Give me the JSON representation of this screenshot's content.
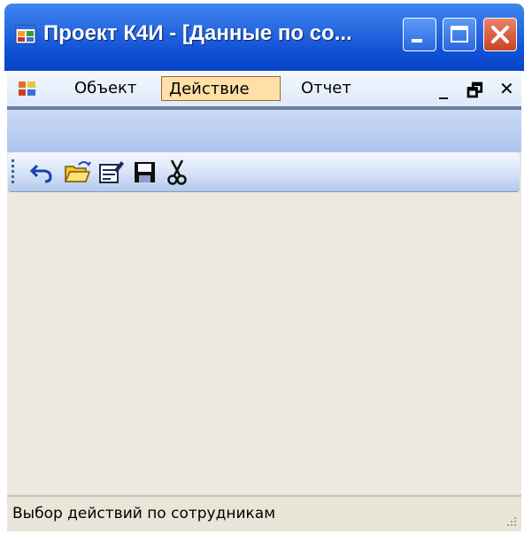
{
  "window": {
    "title": "Проект К4И - [Данные по со...",
    "controls": {
      "minimize": "minimize-icon",
      "maximize": "maximize-icon",
      "close": "close-icon"
    }
  },
  "menu": {
    "items": [
      {
        "label": "Объект"
      },
      {
        "label": "Действие",
        "active": true
      },
      {
        "label": "Отчет"
      }
    ],
    "mdi_controls": {
      "minimize": "_",
      "restore": "🗗",
      "close": "✕"
    }
  },
  "toolbar": {
    "tools": [
      "undo-icon",
      "open-folder-icon",
      "edit-icon",
      "save-icon",
      "cut-icon"
    ]
  },
  "status": {
    "text": "Выбор действий по сотрудникам"
  },
  "colors": {
    "titlebar": "#0e4fd4",
    "menu_active": "#ffe0a8",
    "client": "#eae5d9",
    "toolbar": "#d8e4f8"
  }
}
